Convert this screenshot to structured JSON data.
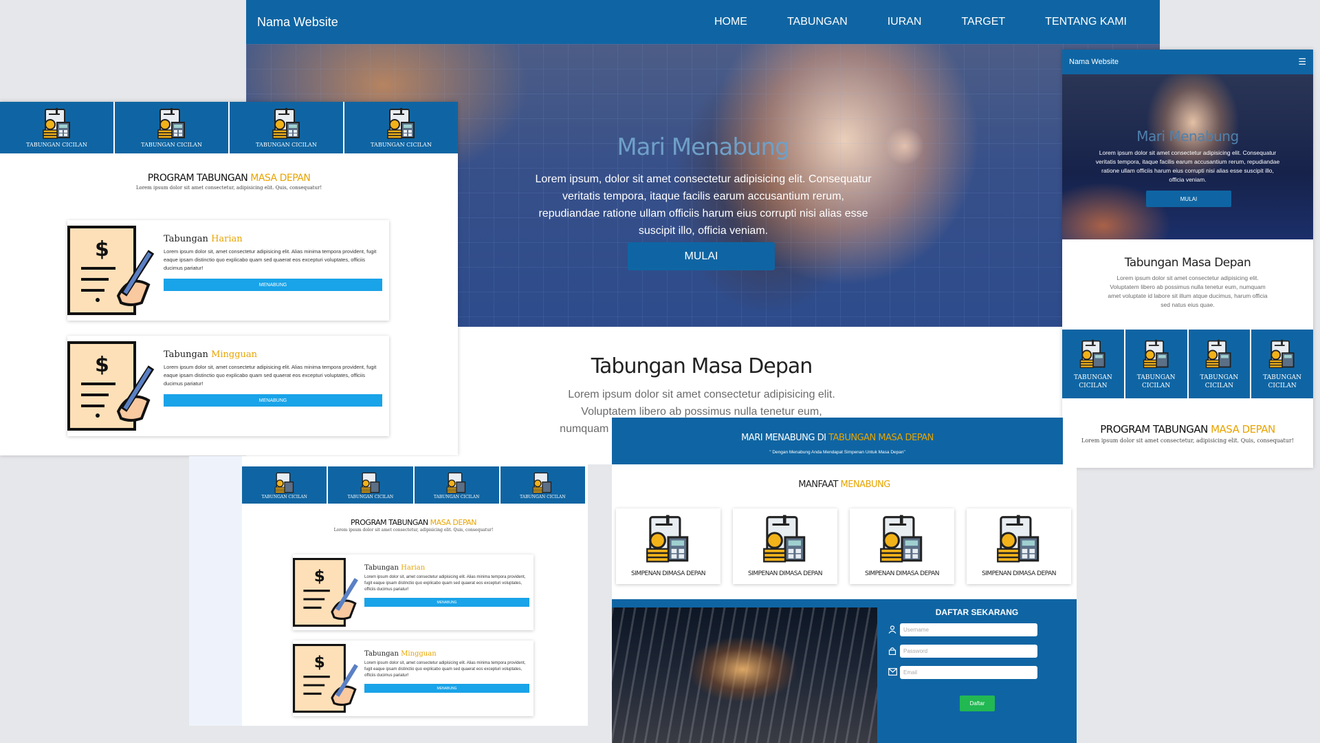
{
  "main": {
    "brand": "Nama Website",
    "nav": [
      "HOME",
      "TABUNGAN",
      "IURAN",
      "TARGET",
      "TENTANG KAMI"
    ],
    "hero_title": "Mari Menabung",
    "hero_text": "Lorem ipsum, dolor sit amet consectetur adipisicing elit. Consequatur veritatis tempora, itaque facilis earum accusantium rerum, repudiandae ratione ullam officiis harum eius corrupti nisi alias esse suscipit illo, officia veniam.",
    "hero_button": "MULAI",
    "section_title": "Tabungan Masa Depan",
    "section_text": "Lorem ipsum dolor sit amet consectetur adipisicing elit. Voluptatem libero ab possimus nulla tenetur eum, numquam amet voluptate id labore sit illum atque ducimus"
  },
  "left": {
    "categories": [
      "TABUNGAN CICILAN",
      "TABUNGAN CICILAN",
      "TABUNGAN CICILAN",
      "TABUNGAN CICILAN"
    ],
    "program_prefix": "PROGRAM TABUNGAN ",
    "program_highlight": "MASA DEPAN",
    "program_sub": "Lorem ipsum dolor sit amet consectetur, adipisicing elit. Quis, consequatur!",
    "cards": [
      {
        "prefix": "Tabungan ",
        "highlight": "Harian",
        "text": "Lorem ipsum dolor sit, amet consectetur adipisicing elit. Alias minima tempora provident, fugit eaque ipsam distinctio quo explicabo quam sed quaerat eos excepturi voluptates, officiis ducimus pariatur!",
        "button": "MENABUNG"
      },
      {
        "prefix": "Tabungan ",
        "highlight": "Mingguan",
        "text": "Lorem ipsum dolor sit, amet consectetur adipisicing elit. Alias minima tempora provident, fugit eaque ipsam distinctio quo explicabo quam sed quaerat eos excepturi voluptates, officiis ducimus pariatur!",
        "button": "MENABUNG"
      }
    ]
  },
  "mobile": {
    "brand": "Nama Website",
    "hero_title": "Mari Menabung",
    "hero_text": "Lorem ipsum dolor sit amet consectetur adipisicing elit. Consequatur veritatis tempora, itaque facilis earum accusantium rerum, repudiandae ratione ullam officiis harum eius corrupti nisi alias esse suscipit illo, officia veniam.",
    "hero_button": "MULAI",
    "section_title": "Tabungan Masa Depan",
    "section_text": "Lorem ipsum dolor sit amet consectetur adipisicing elit. Voluptatem libero ab possimus nulla tenetur eum, numquam amet voluptate id labore sit illum atque ducimus, harum officia sed natus eius quae.",
    "categories": [
      "TABUNGAN CICILAN",
      "TABUNGAN CICILAN",
      "TABUNGAN CICILAN",
      "TABUNGAN CICILAN"
    ],
    "program_prefix": "PROGRAM TABUNGAN ",
    "program_highlight": "MASA DEPAN",
    "program_sub": "Lorem ipsum dolor sit amet consectetur, adipisicing elit. Quis, consequatur!"
  },
  "bottom_left": {
    "categories": [
      "TABUNGAN CICILAN",
      "TABUNGAN CICILAN",
      "TABUNGAN CICILAN",
      "TABUNGAN CICILAN"
    ],
    "program_prefix": "PROGRAM TABUNGAN ",
    "program_highlight": "MASA DEPAN",
    "program_sub": "Lorem ipsum dolor sit amet consectetur, adipisicing elit. Quis, consequatur!",
    "cards": [
      {
        "prefix": "Tabungan ",
        "highlight": "Harian",
        "text": "Lorem ipsum dolor sit, amet consectetur adipisicing elit. Alias minima tempora provident, fugit eaque ipsam distinctio quo explicabo quam sed quaerat eos excepturi voluptates, officiis ducimus pariatur!",
        "button": "MENABUNG"
      },
      {
        "prefix": "Tabungan ",
        "highlight": "Mingguan",
        "text": "Lorem ipsum dolor sit, amet consectetur adipisicing elit. Alias minima tempora provident, fugit eaque ipsam distinctio quo explicabo quam sed quaerat eos excepturi voluptates, officiis ducimus pariatur!",
        "button": "MENABUNG"
      }
    ]
  },
  "bottom_right": {
    "banner_prefix": "MARI MENABUNG DI ",
    "banner_highlight": "TABUNGAN MASA DEPAN",
    "banner_sub": "\" Dengan Menabung Anda Mendapat Simpenan Untuk Masa Depan\"",
    "benefit_prefix": "MANFAAT ",
    "benefit_highlight": "MENABUNG",
    "benefits": [
      "SIMPENAN DIMASA DEPAN",
      "SIMPENAN DIMASA DEPAN",
      "SIMPENAN DIMASA DEPAN",
      "SIMPENAN DIMASA DEPAN"
    ],
    "form_title": "DAFTAR SEKARANG",
    "username_placeholder": "Username",
    "password_placeholder": "Password",
    "email_placeholder": "Email",
    "submit": "Daftar"
  },
  "colors": {
    "primary": "#0f65a3",
    "accent": "#e8a400",
    "button": "#19a3e8",
    "submit": "#22b852"
  },
  "icons": [
    "calculator-coins-icon",
    "signing-document-icon",
    "user-icon",
    "lock-icon",
    "mail-icon",
    "hamburger-menu-icon"
  ]
}
